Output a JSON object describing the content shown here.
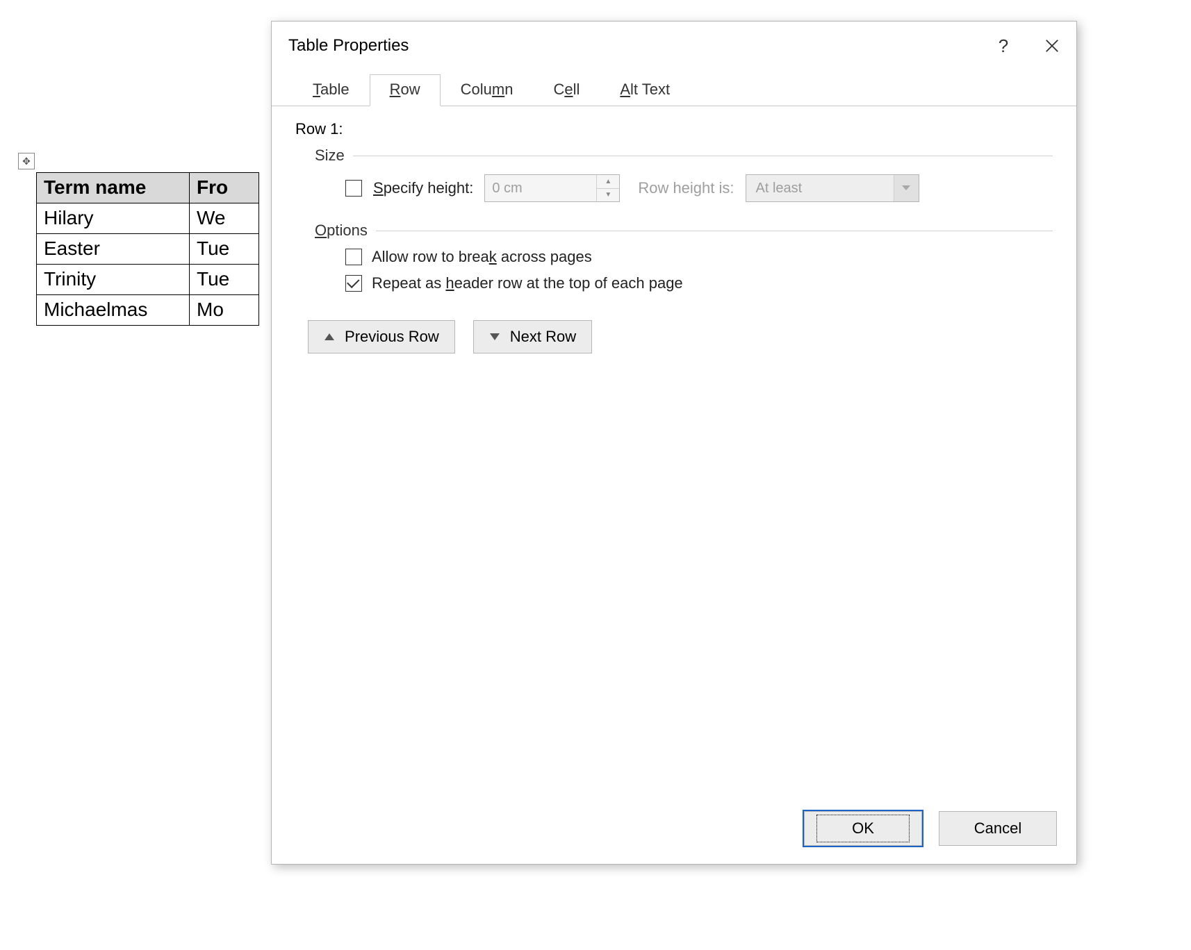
{
  "doc_table": {
    "headers": [
      "Term name",
      "Fro"
    ],
    "rows": [
      [
        "Hilary",
        "We"
      ],
      [
        "Easter",
        "Tue"
      ],
      [
        "Trinity",
        "Tue"
      ],
      [
        "Michaelmas",
        "Mo"
      ]
    ]
  },
  "dialog": {
    "title": "Table Properties",
    "help": "?",
    "tabs": {
      "table": {
        "pre": "",
        "u": "T",
        "post": "able"
      },
      "row": {
        "pre": "",
        "u": "R",
        "post": "ow"
      },
      "column": {
        "pre": "Colu",
        "u": "m",
        "post": "n"
      },
      "cell": {
        "pre": "C",
        "u": "e",
        "post": "ll"
      },
      "alttext": {
        "pre": "",
        "u": "A",
        "post": "lt Text"
      }
    },
    "row_label": "Row 1:",
    "size_group": "Size",
    "specify_height": {
      "pre": "",
      "u": "S",
      "post": "pecify height:"
    },
    "height_value": "0 cm",
    "height_is_label": "Row height is:",
    "height_is_value": "At least",
    "options_group": {
      "pre": "",
      "u": "O",
      "post": "ptions"
    },
    "allow_break": {
      "pre": "Allow row to brea",
      "u": "k",
      "post": " across pages"
    },
    "repeat_header": {
      "pre": "Repeat as ",
      "u": "h",
      "post": "eader row at the top of each page"
    },
    "prev_row": {
      "pre": "",
      "u": "P",
      "post": "revious Row"
    },
    "next_row": {
      "pre": "",
      "u": "N",
      "post": "ext Row"
    },
    "ok": "OK",
    "cancel": "Cancel"
  }
}
